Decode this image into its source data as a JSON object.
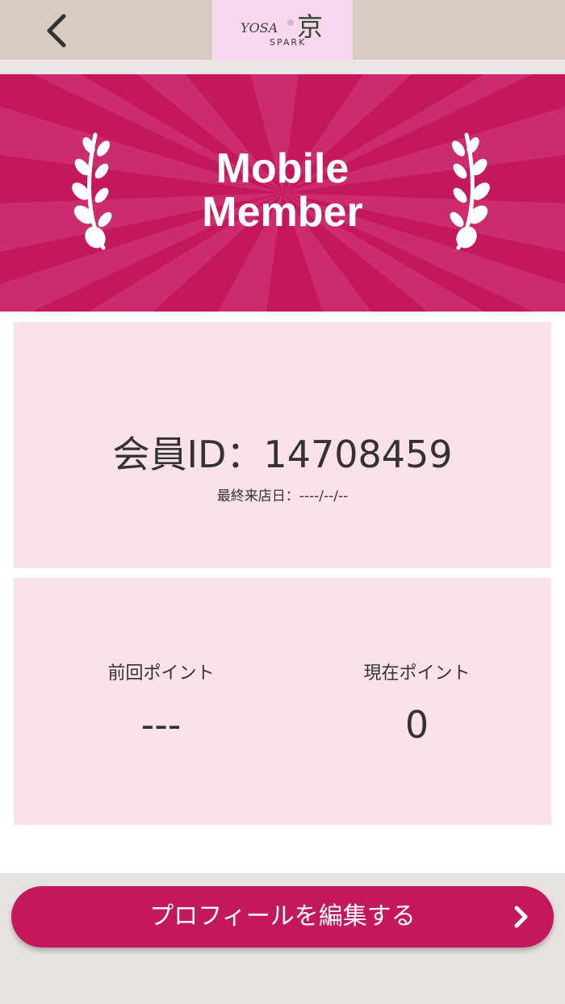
{
  "header": {
    "logo_text_top": "YOSA",
    "logo_kanji": "京",
    "logo_text_bottom": "SPARK"
  },
  "banner": {
    "title_line1": "Mobile",
    "title_line2": "Member"
  },
  "member": {
    "id_label": "会員ID：14708459",
    "last_visit": "最終来店日：----/--/--"
  },
  "points": {
    "previous_label": "前回ポイント",
    "previous_value": "---",
    "current_label": "現在ポイント",
    "current_value": "0"
  },
  "footer": {
    "profile_button_label": "プロフィールを編集する"
  },
  "colors": {
    "accent": "#c4185c",
    "card": "#fbe2ea",
    "header": "#d8cbc2"
  }
}
